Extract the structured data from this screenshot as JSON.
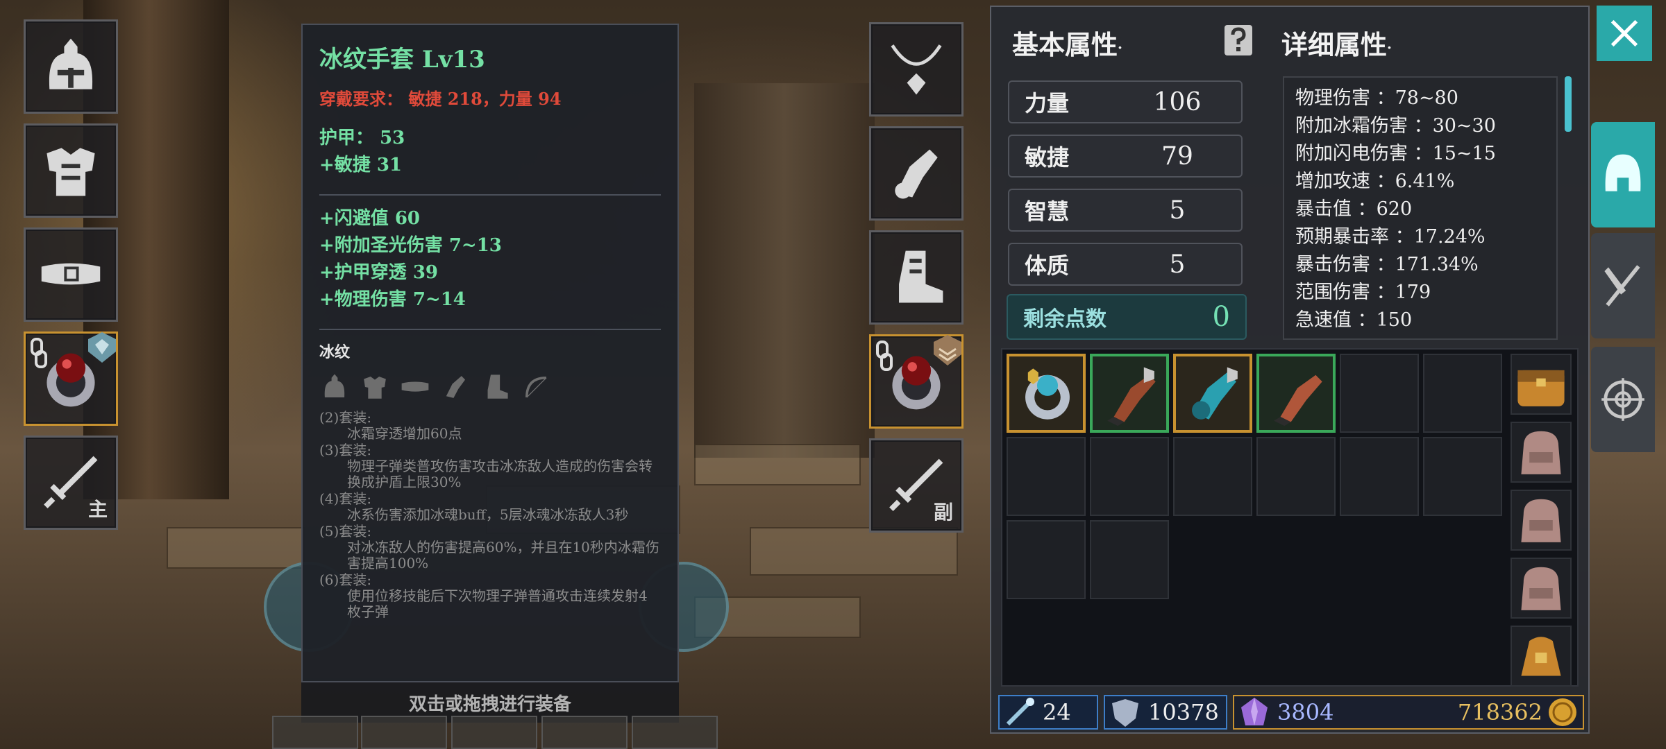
{
  "tooltip": {
    "title": "冰纹手套 Lv13",
    "requirement": "穿戴要求：  敏捷 218，力量 94",
    "base_stats": [
      "护甲：  53",
      "+敏捷 31"
    ],
    "extra_stats": [
      "+闪避值  60",
      "+附加圣光伤害  7~13",
      "+护甲穿透  39",
      "+物理伤害  7~14"
    ],
    "set_name": "冰纹",
    "set_icons": [
      "helmet-icon",
      "armor-icon",
      "belt-icon",
      "glove-icon",
      "boot-icon",
      "bow-icon"
    ],
    "set_bonuses": [
      {
        "label": "(2)套装:",
        "desc": "冰霜穿透增加60点"
      },
      {
        "label": "(3)套装:",
        "desc": "物理子弹类普攻伤害攻击冰冻敌人造成的伤害会转换成护盾上限30%"
      },
      {
        "label": "(4)套装:",
        "desc": "冰系伤害添加冰魂buff，5层冰魂冰冻敌人3秒"
      },
      {
        "label": "(5)套装:",
        "desc": "对冰冻敌人的伤害提高60%，并且在10秒内冰霜伤害提高100%"
      },
      {
        "label": "(6)套装:",
        "desc": "使用位移技能后下次物理子弹普通攻击连续发射4枚子弹"
      }
    ]
  },
  "equip_hint": "双击或拖拽进行装备",
  "slots": {
    "main_weapon_tag": "主",
    "off_weapon_tag": "副"
  },
  "panel": {
    "base_title": "基本属性",
    "detail_title": "详细属性",
    "title_marker": "·",
    "base_stats": [
      {
        "label": "力量",
        "value": "106"
      },
      {
        "label": "敏捷",
        "value": "79"
      },
      {
        "label": "智慧",
        "value": "5"
      },
      {
        "label": "体质",
        "value": "5"
      }
    ],
    "remaining_label": "剩余点数",
    "remaining_value": "0",
    "detail_stats": [
      "物理伤害 ：78~80",
      "附加冰霜伤害 ：30~30",
      "附加闪电伤害 ：15~15",
      "增加攻速 ：6.41%",
      "暴击值 ：620",
      "预期暴击率 ：17.24%",
      "暴击伤害 ：171.34%",
      "范围伤害 ：179",
      "急速值 ：150"
    ]
  },
  "currency": {
    "wand_count": "24",
    "shield_count": "10378",
    "crystal_count": "3804",
    "gold_count": "718362"
  },
  "colors": {
    "accent_teal": "#2aa9a9",
    "item_green": "#74e0a4",
    "requirement_red": "#e04a3a",
    "rarity_gold": "#c89230",
    "rarity_green": "#3aa85a"
  }
}
